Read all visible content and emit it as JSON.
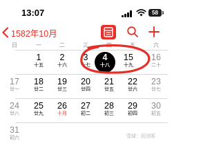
{
  "status_bar": {
    "time": "13:07",
    "battery": "58"
  },
  "nav": {
    "back_title": "1582年10月",
    "view_icon": "calendar-list-icon",
    "search_icon": "search-icon",
    "add_icon": "plus-icon"
  },
  "weekdays": [
    "日",
    "一",
    "二",
    "三",
    "四",
    "五",
    "六"
  ],
  "rows": [
    [
      {
        "day": "",
        "lunar": ""
      },
      {
        "day": "1",
        "lunar": "十五"
      },
      {
        "day": "2",
        "lunar": "十六"
      },
      {
        "day": "3",
        "lunar": "十七"
      },
      {
        "day": "4",
        "lunar": "十八"
      },
      {
        "day": "15",
        "lunar": "十九"
      },
      {
        "day": "16",
        "lunar": "二十"
      }
    ],
    [
      {
        "day": "17",
        "lunar": "廿一"
      },
      {
        "day": "18",
        "lunar": "廿二"
      },
      {
        "day": "19",
        "lunar": "廿三"
      },
      {
        "day": "20",
        "lunar": "廿四"
      },
      {
        "day": "21",
        "lunar": "廿五"
      },
      {
        "day": "22",
        "lunar": "廿六"
      },
      {
        "day": "23",
        "lunar": "廿七"
      }
    ],
    [
      {
        "day": "24",
        "lunar": "廿八"
      },
      {
        "day": "25",
        "lunar": "廿九"
      },
      {
        "day": "26",
        "lunar": "十月"
      },
      {
        "day": "27",
        "lunar": "初二"
      },
      {
        "day": "28",
        "lunar": "初三"
      },
      {
        "day": "29",
        "lunar": "初四"
      },
      {
        "day": "30",
        "lunar": "初五"
      }
    ],
    [
      {
        "day": "31",
        "lunar": "初六"
      }
    ]
  ],
  "selected_day": "4",
  "today_day": "26",
  "colors": {
    "accent": "#e5302a",
    "selected": "#000000",
    "weekend": "#8e8e93"
  },
  "watermark": "雪球：回测客"
}
